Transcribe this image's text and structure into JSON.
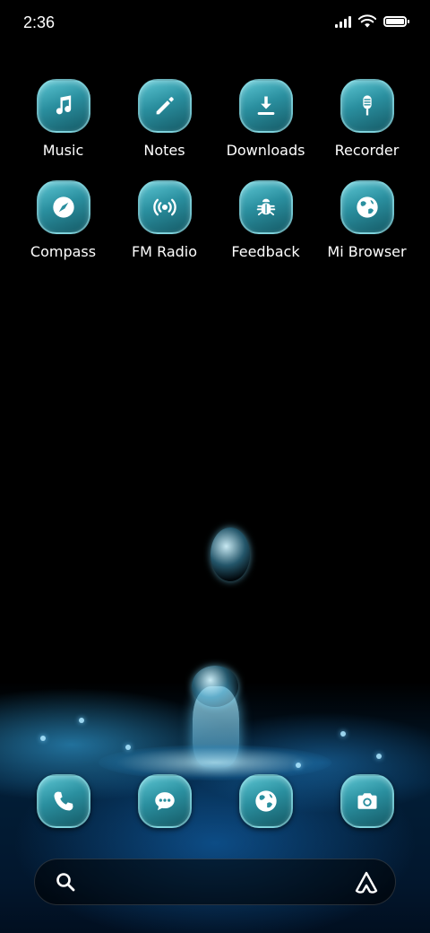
{
  "status_bar": {
    "time": "2:36",
    "battery_level": 1.0,
    "icons": [
      "signal-icon",
      "wifi-icon",
      "battery-icon"
    ]
  },
  "apps": [
    {
      "label": "Music",
      "icon": "music-note-icon"
    },
    {
      "label": "Notes",
      "icon": "pencil-icon"
    },
    {
      "label": "Downloads",
      "icon": "download-icon"
    },
    {
      "label": "Recorder",
      "icon": "microphone-icon"
    },
    {
      "label": "Compass",
      "icon": "compass-icon"
    },
    {
      "label": "FM Radio",
      "icon": "radio-icon"
    },
    {
      "label": "Feedback",
      "icon": "bug-icon"
    },
    {
      "label": "Mi Browser",
      "icon": "globe-icon"
    }
  ],
  "dock": [
    {
      "icon": "phone-icon"
    },
    {
      "icon": "messages-icon"
    },
    {
      "icon": "globe-icon"
    },
    {
      "icon": "camera-icon"
    }
  ],
  "search_bar": {
    "icons": [
      "search-icon",
      "assistant-icon"
    ]
  },
  "colors": {
    "icon_gradient_top": "#5cc6d3",
    "icon_gradient_bottom": "#155a66",
    "background": "#000000"
  }
}
